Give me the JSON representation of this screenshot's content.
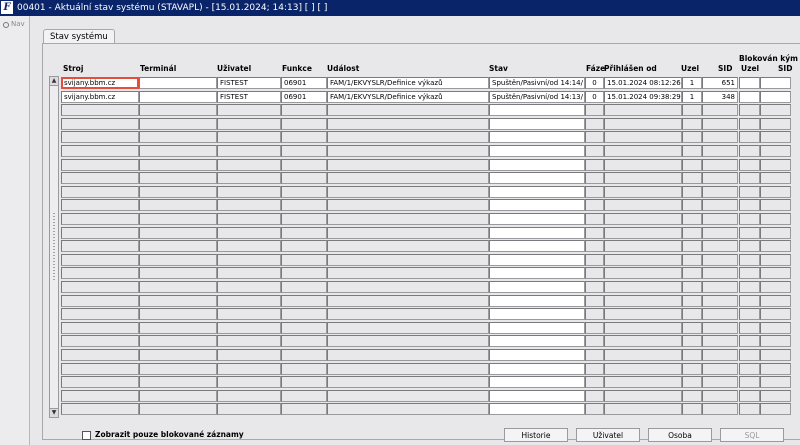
{
  "titlebar": {
    "title": "00401 - Aktuální stav systému (STAVAPL) - [15.01.2024; 14:13] [ ] [ ]",
    "icon": "F"
  },
  "nav": {
    "label": "Nav"
  },
  "tab": {
    "label": "Stav systému"
  },
  "columns": {
    "stroj": "Stroj",
    "terminal": "Terminál",
    "uzivatel": "Uživatel",
    "funkce": "Funkce",
    "udalost": "Událost",
    "stav": "Stav",
    "faze": "Fáze",
    "prihlasen": "Přihlášen od",
    "uzel": "Uzel",
    "sid": "SID",
    "blokovan": "Blokován kým",
    "b_uzel": "Uzel",
    "b_sid": "SID"
  },
  "rows": [
    {
      "stroj": "svijany.bbm.cz",
      "terminal": "",
      "uzivatel": "FISTEST",
      "funkce": "06901",
      "udalost": "FAM/1/EKVYSLR/Definice výkazů",
      "stav": "Spuštěn/Pasivní/od 14:14/",
      "faze": "0",
      "prihlasen": "15.01.2024 08:12:26",
      "uzel": "1",
      "sid": "651"
    },
    {
      "stroj": "svijany.bbm.cz",
      "terminal": "",
      "uzivatel": "FISTEST",
      "funkce": "06901",
      "udalost": "FAM/1/EKVYSLR/Definice výkazů",
      "stav": "Spuštěn/Pasivní/od 14:13/",
      "faze": "0",
      "prihlasen": "15.01.2024 09:38:29",
      "uzel": "1",
      "sid": "348"
    }
  ],
  "footer": {
    "checkbox_label": "Zobrazit pouze blokované záznamy",
    "buttons": {
      "historie": "Historie",
      "uzivatel": "Uživatel",
      "osoba": "Osoba",
      "sql": "SQL"
    }
  }
}
